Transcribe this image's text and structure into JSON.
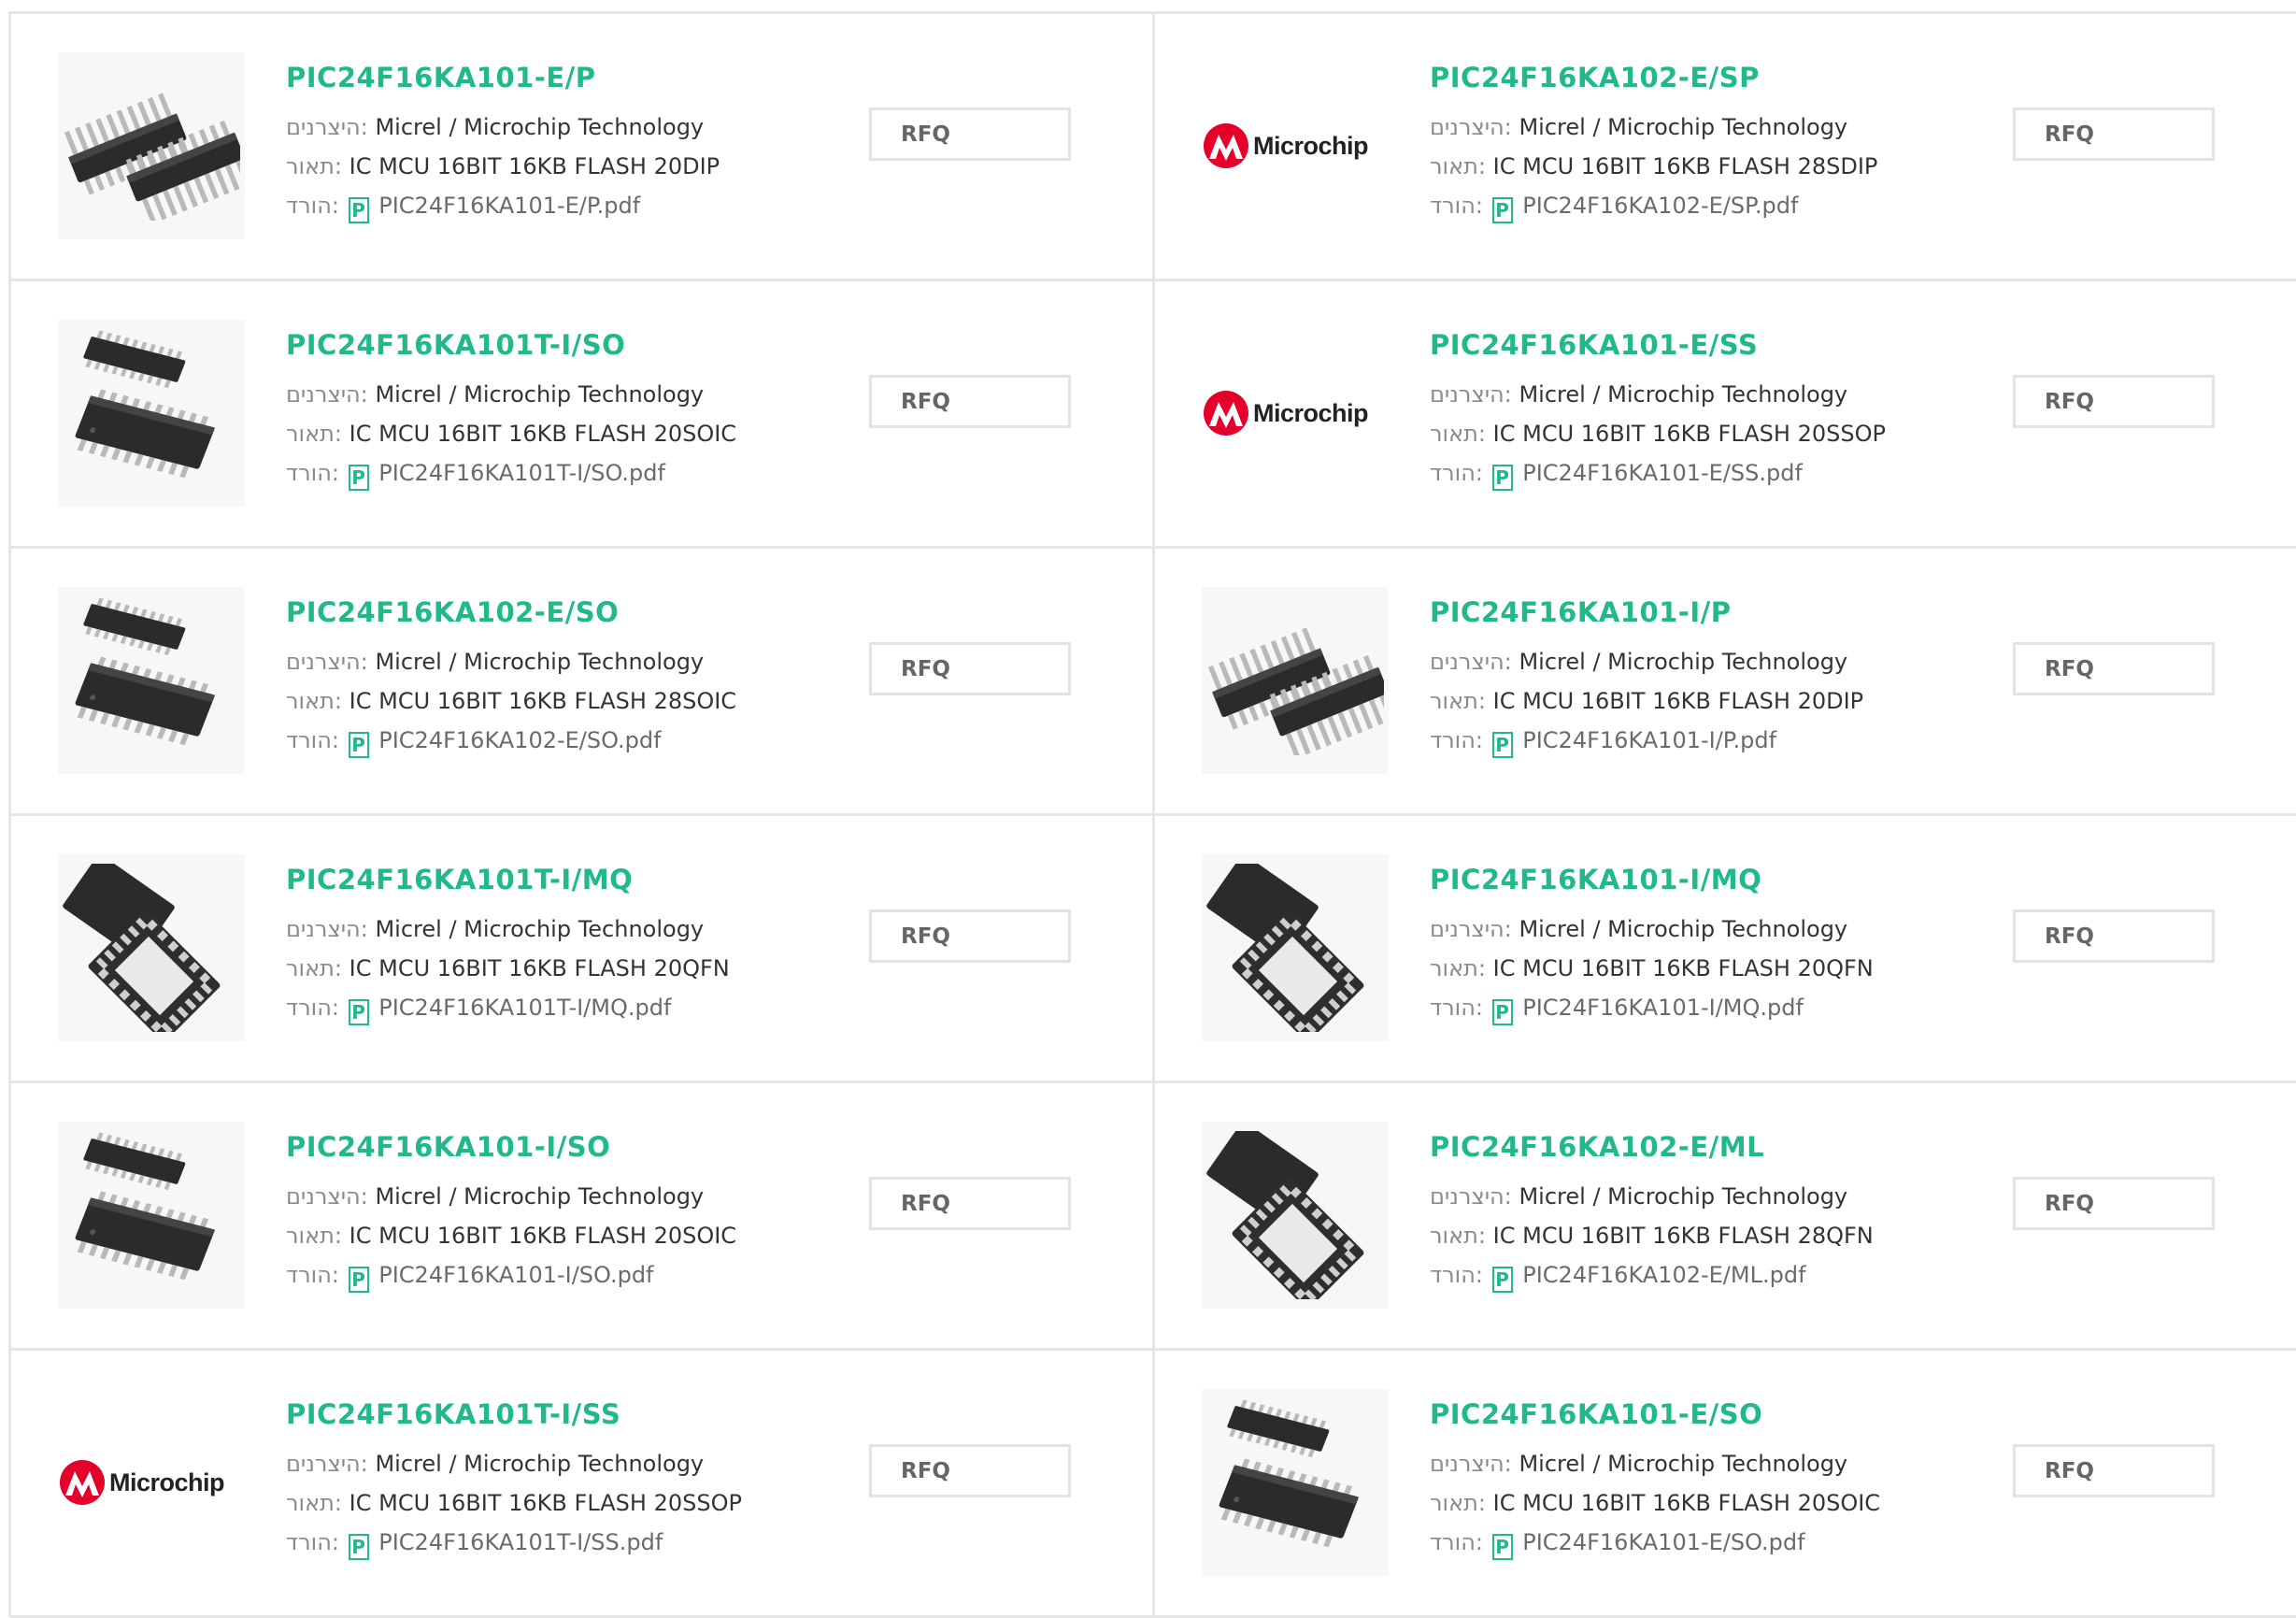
{
  "labels": {
    "manufacturer": "היצרנים:",
    "description": "תאור:",
    "download": "הורד:",
    "rfq": "RFQ",
    "pdf_glyph": "P",
    "logo_text": "Microchip"
  },
  "colors": {
    "accent": "#1fb98a",
    "border": "#e6e6e6",
    "logo_red": "#e4002b"
  },
  "products": [
    {
      "part": "PIC24F16KA101-E/P",
      "manufacturer": "Micrel / Microchip Technology",
      "description": "IC MCU 16BIT 16KB FLASH 20DIP",
      "pdf": "PIC24F16KA101-E/P.pdf",
      "image": "dip-package"
    },
    {
      "part": "PIC24F16KA102-E/SP",
      "manufacturer": "Micrel / Microchip Technology",
      "description": "IC MCU 16BIT 16KB FLASH 28SDIP",
      "pdf": "PIC24F16KA102-E/SP.pdf",
      "image": "microchip-logo"
    },
    {
      "part": "PIC24F16KA101T-I/SO",
      "manufacturer": "Micrel / Microchip Technology",
      "description": "IC MCU 16BIT 16KB FLASH 20SOIC",
      "pdf": "PIC24F16KA101T-I/SO.pdf",
      "image": "soic-package"
    },
    {
      "part": "PIC24F16KA101-E/SS",
      "manufacturer": "Micrel / Microchip Technology",
      "description": "IC MCU 16BIT 16KB FLASH 20SSOP",
      "pdf": "PIC24F16KA101-E/SS.pdf",
      "image": "microchip-logo"
    },
    {
      "part": "PIC24F16KA102-E/SO",
      "manufacturer": "Micrel / Microchip Technology",
      "description": "IC MCU 16BIT 16KB FLASH 28SOIC",
      "pdf": "PIC24F16KA102-E/SO.pdf",
      "image": "soic-package"
    },
    {
      "part": "PIC24F16KA101-I/P",
      "manufacturer": "Micrel / Microchip Technology",
      "description": "IC MCU 16BIT 16KB FLASH 20DIP",
      "pdf": "PIC24F16KA101-I/P.pdf",
      "image": "dip-package"
    },
    {
      "part": "PIC24F16KA101T-I/MQ",
      "manufacturer": "Micrel / Microchip Technology",
      "description": "IC MCU 16BIT 16KB FLASH 20QFN",
      "pdf": "PIC24F16KA101T-I/MQ.pdf",
      "image": "qfn-package"
    },
    {
      "part": "PIC24F16KA101-I/MQ",
      "manufacturer": "Micrel / Microchip Technology",
      "description": "IC MCU 16BIT 16KB FLASH 20QFN",
      "pdf": "PIC24F16KA101-I/MQ.pdf",
      "image": "qfn-package"
    },
    {
      "part": "PIC24F16KA101-I/SO",
      "manufacturer": "Micrel / Microchip Technology",
      "description": "IC MCU 16BIT 16KB FLASH 20SOIC",
      "pdf": "PIC24F16KA101-I/SO.pdf",
      "image": "soic-package"
    },
    {
      "part": "PIC24F16KA102-E/ML",
      "manufacturer": "Micrel / Microchip Technology",
      "description": "IC MCU 16BIT 16KB FLASH 28QFN",
      "pdf": "PIC24F16KA102-E/ML.pdf",
      "image": "qfn-package"
    },
    {
      "part": "PIC24F16KA101T-I/SS",
      "manufacturer": "Micrel / Microchip Technology",
      "description": "IC MCU 16BIT 16KB FLASH 20SSOP",
      "pdf": "PIC24F16KA101T-I/SS.pdf",
      "image": "microchip-logo"
    },
    {
      "part": "PIC24F16KA101-E/SO",
      "manufacturer": "Micrel / Microchip Technology",
      "description": "IC MCU 16BIT 16KB FLASH 20SOIC",
      "pdf": "PIC24F16KA101-E/SO.pdf",
      "image": "soic-package"
    }
  ]
}
